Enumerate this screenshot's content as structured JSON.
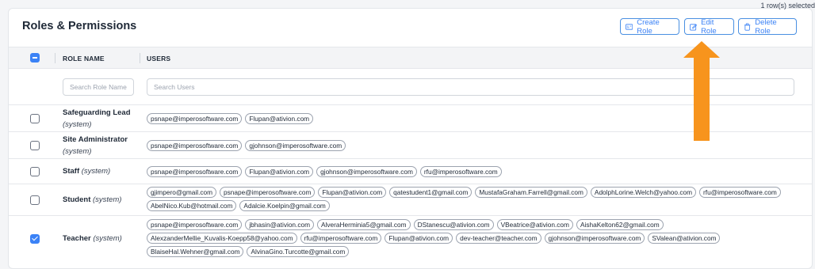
{
  "panel": {
    "title": "Roles & Permissions",
    "selection_count": "1 row(s) selected"
  },
  "toolbar": {
    "create_label": "Create Role",
    "edit_label": "Edit Role",
    "delete_label": "Delete Role"
  },
  "table": {
    "columns": [
      "ROLE NAME",
      "USERS"
    ],
    "filters": {
      "role_placeholder": "Search Role Name",
      "users_placeholder": "Search Users"
    },
    "rows": [
      {
        "name": "Safeguarding Lead",
        "system": "(system)",
        "checked": false,
        "users": [
          "psnape@imperosoftware.com",
          "Flupan@ativion.com"
        ]
      },
      {
        "name": "Site Administrator",
        "system": "(system)",
        "checked": false,
        "users": [
          "psnape@imperosoftware.com",
          "gjohnson@imperosoftware.com"
        ]
      },
      {
        "name": "Staff",
        "system": "(system)",
        "checked": false,
        "users": [
          "psnape@imperosoftware.com",
          "Flupan@ativion.com",
          "gjohnson@imperosoftware.com",
          "rfu@imperosoftware.com"
        ]
      },
      {
        "name": "Student",
        "system": "(system)",
        "checked": false,
        "users": [
          "gjimpero@gmail.com",
          "psnape@imperosoftware.com",
          "Flupan@ativion.com",
          "qatestudent1@gmail.com",
          "MustafaGraham.Farrell@gmail.com",
          "AdolphLorine.Welch@yahoo.com",
          "rfu@imperosoftware.com",
          "AbelNico.Kub@hotmail.com",
          "Adalcie.Koelpin@gmail.com"
        ]
      },
      {
        "name": "Teacher",
        "system": "(system)",
        "checked": true,
        "users": [
          "psnape@imperosoftware.com",
          "jbhasin@ativion.com",
          "AlveraHerminia5@gmail.com",
          "DStanescu@ativion.com",
          "VBeatrice@ativion.com",
          "AishaKelton62@gmail.com",
          "AlexzanderMellie_Kuvalis-Koepp58@yahoo.com",
          "rfu@imperosoftware.com",
          "Flupan@ativion.com",
          "dev-teacher@teacher.com",
          "gjohnson@imperosoftware.com",
          "SValean@ativion.com",
          "BlaiseHal.Wehner@gmail.com",
          "AlvinaGino.Turcotte@gmail.com"
        ]
      }
    ]
  },
  "icons": {
    "create": "id-card-icon",
    "edit": "edit-icon",
    "delete": "trash-icon"
  },
  "colors": {
    "accent": "#3b82f6",
    "annotation_arrow": "#f7941d"
  }
}
